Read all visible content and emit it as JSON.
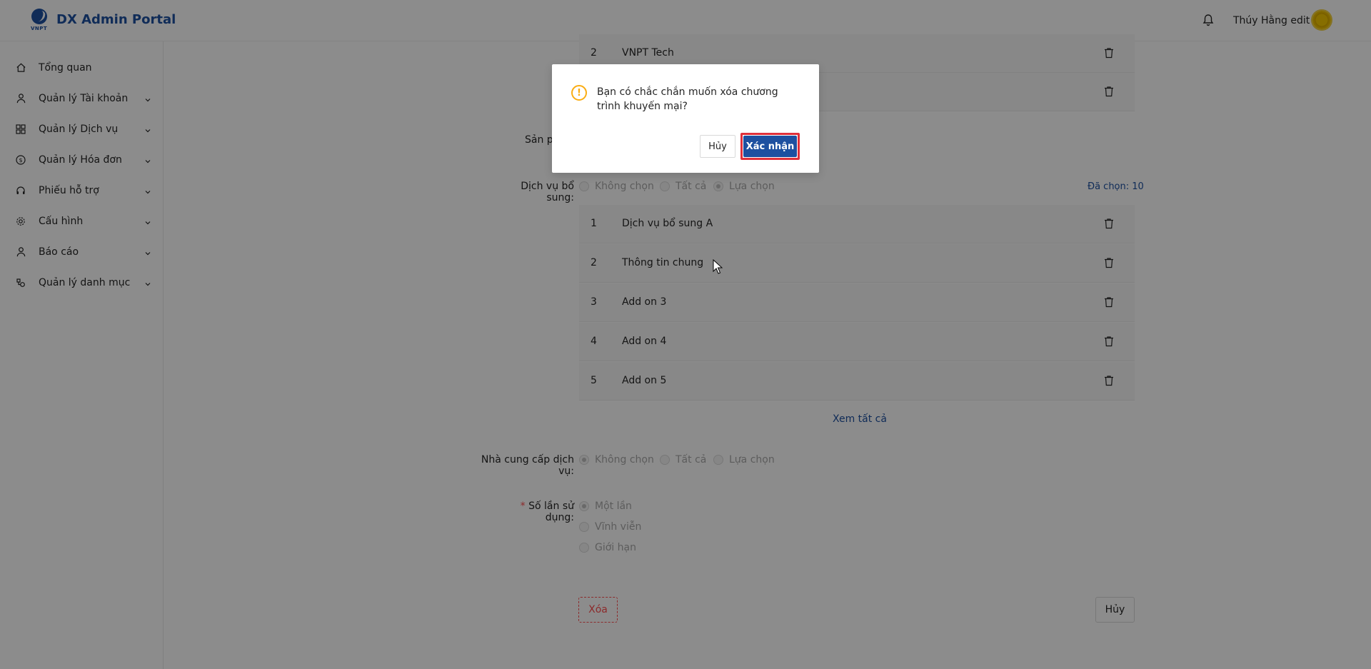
{
  "header": {
    "logo_text": "VNPT",
    "brand": "DX Admin Portal",
    "user_name": "Thúy Hằng edit"
  },
  "sidebar": {
    "items": [
      {
        "label": "Tổng quan",
        "icon": "home-icon"
      },
      {
        "label": "Quản lý Tài khoản",
        "icon": "user-icon"
      },
      {
        "label": "Quản lý Dịch vụ",
        "icon": "grid-icon"
      },
      {
        "label": "Quản lý Hóa đơn",
        "icon": "dollar-icon"
      },
      {
        "label": "Phiếu hỗ trợ",
        "icon": "headset-icon"
      },
      {
        "label": "Cấu hình",
        "icon": "gear-icon"
      },
      {
        "label": "Báo cáo",
        "icon": "user-icon"
      },
      {
        "label": "Quản lý danh mục",
        "icon": "category-icon"
      }
    ]
  },
  "form": {
    "top_rows": [
      {
        "num": "2",
        "name": "VNPT Tech"
      }
    ],
    "products_label_partial": "Sản p",
    "addon_label": "Dịch vụ bổ sung",
    "addon_options": [
      "Không chọn",
      "Tất cả",
      "Lựa chọn"
    ],
    "addon_selected_count": "Đã chọn: 10",
    "addon_rows": [
      {
        "num": "1",
        "name": "Dịch vụ bổ sung A"
      },
      {
        "num": "2",
        "name": "Thông tin chung"
      },
      {
        "num": "3",
        "name": "Add on 3"
      },
      {
        "num": "4",
        "name": "Add on 4"
      },
      {
        "num": "5",
        "name": "Add on 5"
      }
    ],
    "view_all": "Xem tất cả",
    "provider_label": "Nhà cung cấp dịch vụ",
    "provider_options": [
      "Không chọn",
      "Tất cả",
      "Lựa chọn"
    ],
    "usage_label": "Số lần sử dụng",
    "usage_required_mark": "*",
    "usage_options": [
      "Một lần",
      "Vĩnh viễn",
      "Giới hạn"
    ],
    "delete_button": "Xóa",
    "cancel_button": "Hủy"
  },
  "modal": {
    "message": "Bạn có chắc chắn muốn xóa chương trình khuyến mại?",
    "warning_glyph": "!",
    "cancel_label": "Hủy",
    "confirm_label": "Xác nhận"
  },
  "colors": {
    "brand": "#1e50a0",
    "danger": "#ff4d4f",
    "warning": "#faad14",
    "highlight": "#e0303a"
  }
}
